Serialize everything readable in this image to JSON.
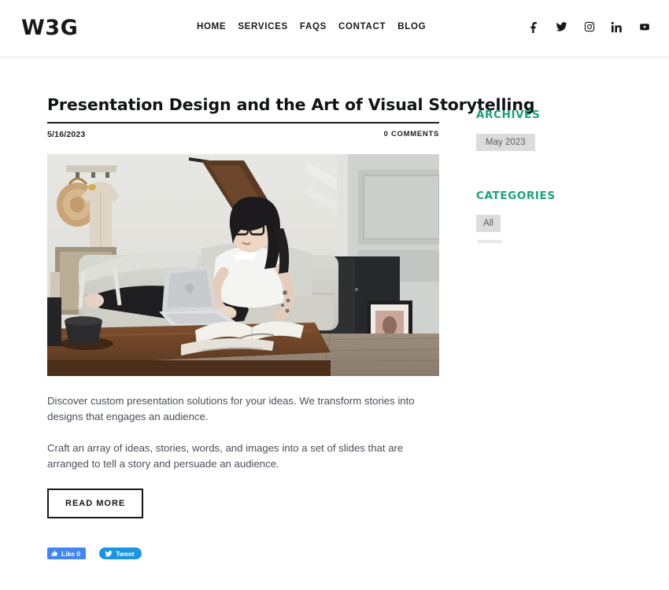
{
  "header": {
    "logo": "W3G",
    "nav": [
      {
        "label": "HOME",
        "name": "nav-item-home"
      },
      {
        "label": "SERVICES",
        "name": "nav-item-services"
      },
      {
        "label": "FAQS",
        "name": "nav-item-faqs"
      },
      {
        "label": "CONTACT",
        "name": "nav-item-contact"
      },
      {
        "label": "BLOG",
        "name": "nav-item-blog"
      }
    ],
    "social": [
      {
        "icon": "facebook-icon",
        "label": "Facebook"
      },
      {
        "icon": "twitter-icon",
        "label": "Twitter"
      },
      {
        "icon": "instagram-icon",
        "label": "Instagram"
      },
      {
        "icon": "linkedin-icon",
        "label": "LinkedIn"
      },
      {
        "icon": "youtube-icon",
        "label": "YouTube"
      }
    ]
  },
  "post": {
    "title": "Presentation Design and the Art of Visual Storytelling",
    "date": "5/16/2023",
    "comments": "0 COMMENTS",
    "image_alt": "Woman with glasses working on a laptop while sitting on a light gray sofa in a bright living room",
    "paragraph_1": "Discover custom presentation solutions for your ideas. We transform stories into designs that engages an audience.",
    "paragraph_2": "Craft an array of ideas, stories, words, and images into a set of slides that are arranged to tell a story and persuade an audience.",
    "read_more": "READ MORE"
  },
  "share": {
    "facebook_label": "Like 0",
    "twitter_label": "Tweet"
  },
  "sidebar": {
    "archives": {
      "heading": "ARCHIVES",
      "items": [
        {
          "label": "May 2023"
        }
      ]
    },
    "categories": {
      "heading": "CATEGORIES",
      "items": [
        {
          "label": "All"
        }
      ]
    }
  },
  "colors": {
    "accent_green": "#1aa179",
    "text_dark": "#17181a",
    "body_text": "#4b4f57",
    "pill_bg": "#dcdcdc",
    "facebook_blue": "#4285f4",
    "twitter_blue": "#1b95e0"
  }
}
